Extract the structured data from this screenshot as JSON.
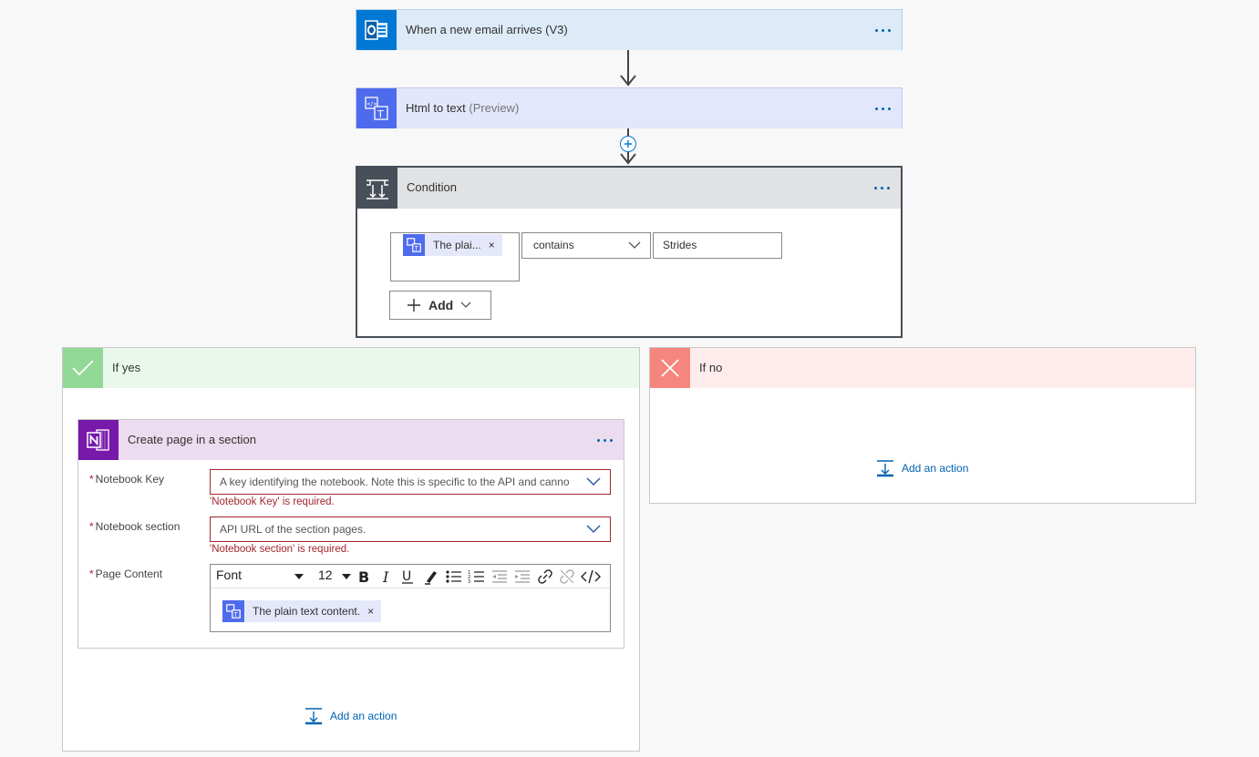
{
  "steps": {
    "trigger": {
      "title": "When a new email arrives (V3)"
    },
    "html_to_text": {
      "title": "Html to text",
      "badge": "(Preview)"
    },
    "condition": {
      "title": "Condition",
      "token_label": "The plai...",
      "operator": "contains",
      "value": "Strides",
      "add_label": "Add"
    }
  },
  "branch_yes": {
    "title": "If yes",
    "action": {
      "title": "Create page in a section",
      "notebook_key_label": "Notebook Key",
      "notebook_key_placeholder": "A key identifying the notebook. Note this is specific to the API and canno",
      "notebook_key_error": "'Notebook Key' is required.",
      "notebook_section_label": "Notebook section",
      "notebook_section_placeholder": "API URL of the section pages.",
      "notebook_section_error": "'Notebook section' is required.",
      "page_content_label": "Page Content",
      "font_label": "Font",
      "font_size": "12",
      "content_token": "The plain text content."
    },
    "add_action": "Add an action"
  },
  "branch_no": {
    "title": "If no",
    "add_action": "Add an action"
  },
  "required_marker": "*",
  "colors": {
    "outlook": "#0078d4",
    "html_to_text": "#4f6bed",
    "condition": "#484f58",
    "yes": "#92d896",
    "no": "#f4867d",
    "onenote": "#7719aa",
    "link": "#0063b1",
    "error": "#a4262c"
  }
}
